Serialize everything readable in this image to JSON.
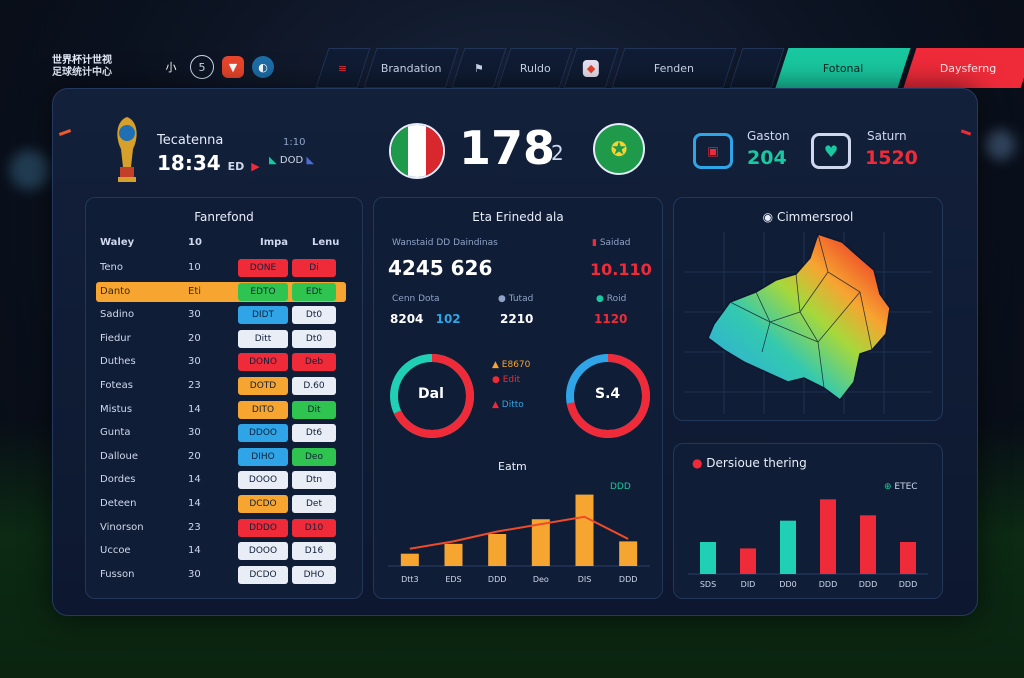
{
  "colors": {
    "accent_green": "#19c8a0",
    "accent_red": "#ef2b3a",
    "orange": "#f6a531",
    "blue": "#2fa4e7",
    "teal": "#1fd0b4"
  },
  "topbar": {
    "logo_line1": "世界杯计世视",
    "logo_line2": "足球统计中心",
    "logo_glyph": "小",
    "items": [
      "Brandation",
      "Ruldo",
      "Fenden"
    ],
    "btn_green": "Fotonal",
    "btn_red": "Daysferng"
  },
  "header": {
    "team_name": "Tecatenna",
    "time": "18:34",
    "time_suffix": "ED",
    "tag1": "1:10",
    "tag2": "DOD",
    "score_main": "178",
    "score_sub": "2",
    "stat1_label": "Gaston",
    "stat1_value": "204",
    "stat2_label": "Saturn",
    "stat2_value": "1520"
  },
  "table": {
    "title": "Fanrefond",
    "headers": [
      "Waley",
      "10",
      "Impa",
      "Lenu"
    ],
    "rows": [
      {
        "name": "Teno",
        "num": "10",
        "v1": "DONE",
        "v2": "Di",
        "c1": "red",
        "c2": "red"
      },
      {
        "name": "Danto",
        "num": "Eti",
        "v1": "EDTO",
        "v2": "EDt",
        "c1": "green",
        "c2": "green",
        "highlight": true
      },
      {
        "name": "Sadino",
        "num": "30",
        "v1": "DIDT",
        "v2": "Dt0",
        "c1": "blue",
        "c2": "white"
      },
      {
        "name": "Fiedur",
        "num": "20",
        "v1": "Ditt",
        "v2": "Dt0",
        "c1": "white",
        "c2": "white"
      },
      {
        "name": "Duthes",
        "num": "30",
        "v1": "DONO",
        "v2": "Deb",
        "c1": "red",
        "c2": "red"
      },
      {
        "name": "Foteas",
        "num": "23",
        "v1": "DOTD",
        "v2": "D.60",
        "c1": "orange",
        "c2": "white"
      },
      {
        "name": "Mistus",
        "num": "14",
        "v1": "DITO",
        "v2": "Dit",
        "c1": "orange",
        "c2": "green"
      },
      {
        "name": "Gunta",
        "num": "30",
        "v1": "DDOO",
        "v2": "Dt6",
        "c1": "blue",
        "c2": "white"
      },
      {
        "name": "Dalloue",
        "num": "20",
        "v1": "DIHO",
        "v2": "Deo",
        "c1": "blue",
        "c2": "green"
      },
      {
        "name": "Dordes",
        "num": "14",
        "v1": "DOOO",
        "v2": "Dtn",
        "c1": "white",
        "c2": "white"
      },
      {
        "name": "Deteen",
        "num": "14",
        "v1": "DCDO",
        "v2": "Det",
        "c1": "orange",
        "c2": "white"
      },
      {
        "name": "Vinorson",
        "num": "23",
        "v1": "DDDO",
        "v2": "D10",
        "c1": "red",
        "c2": "red"
      },
      {
        "name": "Uccoe",
        "num": "14",
        "v1": "DOOO",
        "v2": "D16",
        "c1": "white",
        "c2": "white"
      },
      {
        "name": "Fusson",
        "num": "30",
        "v1": "DCDO",
        "v2": "DHO",
        "c1": "white",
        "c2": "white"
      }
    ]
  },
  "center": {
    "title": "Eta Erinedd ala",
    "label_left": "Wanstaid DD Daindinas",
    "big_left": "4245 626",
    "label_right": "Saidad",
    "big_right": "10.110",
    "sub1_label": "Cenn Dota",
    "sub1_a": "8204",
    "sub1_b": "102",
    "sub2_label": "Tutad",
    "sub2_value": "2210",
    "sub3_label": "Roid",
    "sub3_value": "1120",
    "donut1_value": "Dal",
    "donut2_value": "S.4",
    "donut1_frac": 0.68,
    "donut2_frac": 0.72,
    "legend": [
      "E8670",
      "Edit",
      "Ditto"
    ],
    "bar_title": "Eatm",
    "bar_note": "DDD"
  },
  "map": {
    "title": "Cimmersrool"
  },
  "right_chart": {
    "title": "Dersioue thering",
    "legend": "ETEC"
  },
  "chart_data": [
    {
      "type": "bar",
      "title": "Eatm",
      "categories": [
        "Dtt3",
        "EDS",
        "DDD",
        "Deo",
        "DIS",
        "DDD"
      ],
      "values": [
        10,
        18,
        26,
        38,
        58,
        20
      ],
      "ylim": [
        0,
        65
      ],
      "line": [
        14,
        20,
        28,
        34,
        40,
        22
      ]
    },
    {
      "type": "bar",
      "title": "Dersioue thering",
      "categories": [
        "SDS",
        "DID",
        "DD0",
        "DDD",
        "DDD",
        "DDD"
      ],
      "values": [
        30,
        24,
        50,
        70,
        55,
        30
      ],
      "colors": [
        "#1fd0b4",
        "#ef2b3a",
        "#1fd0b4",
        "#ef2b3a",
        "#ef2b3a",
        "#ef2b3a"
      ],
      "ylim": [
        0,
        75
      ]
    }
  ]
}
